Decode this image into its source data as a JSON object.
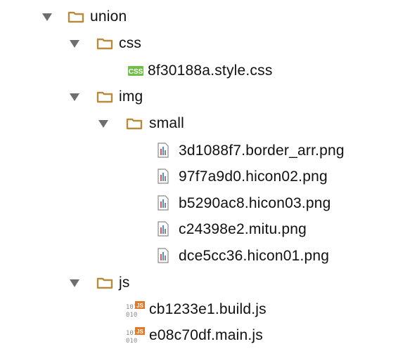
{
  "tree": {
    "root": {
      "label": "union",
      "icon": "folder-icon"
    },
    "css_folder": {
      "label": "css",
      "icon": "folder-icon"
    },
    "css_file": {
      "label": "8f30188a.style.css",
      "icon": "css-file-icon",
      "badge": "CSS"
    },
    "img_folder": {
      "label": "img",
      "icon": "folder-icon"
    },
    "small_folder": {
      "label": "small",
      "icon": "folder-icon"
    },
    "images": [
      {
        "label": "3d1088f7.border_arr.png",
        "icon": "image-file-icon"
      },
      {
        "label": "97f7a9d0.hicon02.png",
        "icon": "image-file-icon"
      },
      {
        "label": "b5290ac8.hicon03.png",
        "icon": "image-file-icon"
      },
      {
        "label": "c24398e2.mitu.png",
        "icon": "image-file-icon"
      },
      {
        "label": "dce5cc36.hicon01.png",
        "icon": "image-file-icon"
      }
    ],
    "js_folder": {
      "label": "js",
      "icon": "folder-icon"
    },
    "js_files": [
      {
        "label": "cb1233e1.build.js",
        "icon": "js-file-icon",
        "badge": "JS",
        "bits": "1010"
      },
      {
        "label": "e08c70df.main.js",
        "icon": "js-file-icon",
        "badge": "JS",
        "bits": "1010"
      }
    ]
  },
  "colors": {
    "folder_stroke": "#b88a3c",
    "folder_fill": "#ffffff",
    "arrow": "#6e6e6e",
    "css_badge": "#6fbf4a",
    "js_badge": "#e07a2b"
  }
}
